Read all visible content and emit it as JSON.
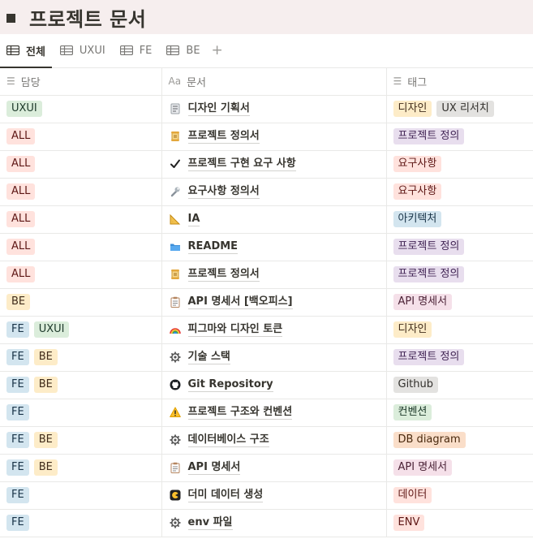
{
  "page": {
    "title": "프로젝트 문서"
  },
  "tabs": [
    {
      "label": "전체",
      "active": true
    },
    {
      "label": "UXUI",
      "active": false
    },
    {
      "label": "FE",
      "active": false
    },
    {
      "label": "BE",
      "active": false
    }
  ],
  "add_tab_label": "+",
  "columns": {
    "owner": "담당",
    "doc": "문서",
    "tags": "태그"
  },
  "tag_colors": {
    "gray": "#e3e2e0",
    "red": "#ffe2dd",
    "orange": "#fadec9",
    "yellow": "#fdecc8",
    "green": "#dbeddb",
    "blue": "#d3e5ef",
    "purple": "#e8deee",
    "pink": "#f5e0e9"
  },
  "rows": [
    {
      "owners": [
        {
          "label": "UXUI",
          "color": "green"
        }
      ],
      "icon": "memo-icon",
      "title": "디자인 기획서",
      "tags": [
        {
          "label": "디자인",
          "color": "yellow"
        },
        {
          "label": "UX 리서치",
          "color": "gray"
        }
      ]
    },
    {
      "owners": [
        {
          "label": "ALL",
          "color": "red"
        }
      ],
      "icon": "scroll-icon",
      "title": "프로젝트 정의서",
      "tags": [
        {
          "label": "프로젝트 정의",
          "color": "purple"
        }
      ]
    },
    {
      "owners": [
        {
          "label": "ALL",
          "color": "red"
        }
      ],
      "icon": "checkmark-icon",
      "title": "프로젝트 구현 요구 사항",
      "tags": [
        {
          "label": "요구사항",
          "color": "red"
        }
      ]
    },
    {
      "owners": [
        {
          "label": "ALL",
          "color": "red"
        }
      ],
      "icon": "wrench-icon",
      "title": "요구사항 정의서",
      "tags": [
        {
          "label": "요구사항",
          "color": "red"
        }
      ]
    },
    {
      "owners": [
        {
          "label": "ALL",
          "color": "red"
        }
      ],
      "icon": "ruler-icon",
      "title": "IA",
      "tags": [
        {
          "label": "아키텍처",
          "color": "blue"
        }
      ]
    },
    {
      "owners": [
        {
          "label": "ALL",
          "color": "red"
        }
      ],
      "icon": "folder-icon",
      "title": "README",
      "tags": [
        {
          "label": "프로젝트 정의",
          "color": "purple"
        }
      ]
    },
    {
      "owners": [
        {
          "label": "ALL",
          "color": "red"
        }
      ],
      "icon": "scroll-icon",
      "title": "프로젝트 정의서",
      "tags": [
        {
          "label": "프로젝트 정의",
          "color": "purple"
        }
      ]
    },
    {
      "owners": [
        {
          "label": "BE",
          "color": "yellow"
        }
      ],
      "icon": "clipboard-icon",
      "title": "API 명세서 [백오피스]",
      "tags": [
        {
          "label": "API 명세서",
          "color": "pink"
        }
      ]
    },
    {
      "owners": [
        {
          "label": "FE",
          "color": "blue"
        },
        {
          "label": "UXUI",
          "color": "green"
        }
      ],
      "icon": "rainbow-icon",
      "title": "피그마와 디자인 토큰",
      "tags": [
        {
          "label": "디자인",
          "color": "yellow"
        }
      ]
    },
    {
      "owners": [
        {
          "label": "FE",
          "color": "blue"
        },
        {
          "label": "BE",
          "color": "yellow"
        }
      ],
      "icon": "gear-icon",
      "title": "기술 스택",
      "tags": [
        {
          "label": "프로젝트 정의",
          "color": "purple"
        }
      ]
    },
    {
      "owners": [
        {
          "label": "FE",
          "color": "blue"
        },
        {
          "label": "BE",
          "color": "yellow"
        }
      ],
      "icon": "github-icon",
      "title": "Git Repository",
      "tags": [
        {
          "label": "Github",
          "color": "gray"
        }
      ]
    },
    {
      "owners": [
        {
          "label": "FE",
          "color": "blue"
        }
      ],
      "icon": "warning-icon",
      "title": "프로젝트 구조와 컨벤션",
      "tags": [
        {
          "label": "컨벤션",
          "color": "green"
        }
      ]
    },
    {
      "owners": [
        {
          "label": "FE",
          "color": "blue"
        },
        {
          "label": "BE",
          "color": "yellow"
        }
      ],
      "icon": "gear-icon",
      "title": "데이터베이스 구조",
      "tags": [
        {
          "label": "DB diagram",
          "color": "orange"
        }
      ]
    },
    {
      "owners": [
        {
          "label": "FE",
          "color": "blue"
        },
        {
          "label": "BE",
          "color": "yellow"
        }
      ],
      "icon": "clipboard-icon",
      "title": "API 명세서",
      "tags": [
        {
          "label": "API 명세서",
          "color": "pink"
        }
      ]
    },
    {
      "owners": [
        {
          "label": "FE",
          "color": "blue"
        }
      ],
      "icon": "pacman-icon",
      "title": "더미 데이터 생성",
      "tags": [
        {
          "label": "데이터",
          "color": "red"
        }
      ]
    },
    {
      "owners": [
        {
          "label": "FE",
          "color": "blue"
        }
      ],
      "icon": "gear-icon",
      "title": "env 파일",
      "tags": [
        {
          "label": "ENV",
          "color": "red"
        }
      ]
    }
  ]
}
